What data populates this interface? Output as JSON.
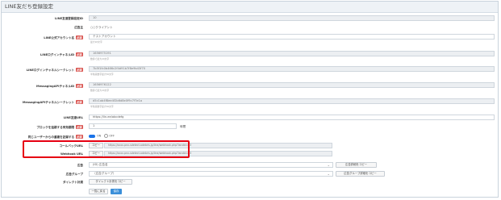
{
  "title": "LINE友だち登録設定",
  "fields": {
    "reg_id": {
      "label": "LINE友達登録設定ID",
      "value": "10"
    },
    "client": {
      "label": "広告主",
      "value": "○○クライアント"
    },
    "account_name": {
      "label": "LINE公式アカウント名",
      "required": "必須",
      "value": "テストアカウント",
      "hint": "最大20文字"
    },
    "login_channel_id": {
      "label": "LINEログインチャネルID",
      "required": "必須",
      "value": "1656975191",
      "hint": "数値で最大20文字"
    },
    "login_channel_secret": {
      "label": "LINEログインチャネルシークレット",
      "required": "必須",
      "value": "7b5f1fc0b466c2f4d91b7f8e9b43f70",
      "hint": "半角英数字最大50文字"
    },
    "msg_channel_id": {
      "label": "MessagingAPIチャネルID",
      "required": "必須",
      "value": "1656976122",
      "hint": "数値で最大20文字"
    },
    "msg_channel_secret": {
      "label": "MessagingAPIチャネルシークレット",
      "required": "必須",
      "value": "d5c1ab4f8ee4f2b6d8e0f9c7f7e1a",
      "hint": "半角英数字最大50文字"
    },
    "friend_url": {
      "label": "LINE友達URL",
      "value": "https://lin.ee/abcdefg"
    },
    "expire": {
      "label": "ブロックを追跡する有効期限",
      "required": "必須",
      "value": "1",
      "unit": "時間"
    },
    "same_user": {
      "label": "同じユーザーからの重複を記録する",
      "required": "必須",
      "on_label": "ON",
      "off_label": "OFF"
    },
    "callback_url": {
      "label": "コールバックURL",
      "copy": "コピー",
      "value": "https://xxxx.pnx-sdetect.adebris.jp/line/webhook.php?landid=23"
    },
    "webhook_url": {
      "label": "Webhook URL",
      "copy": "コピー",
      "value": "https://xxxx.pnx-sdetect.adebris.jp/line/webhook.php?landid=23"
    },
    "ad": {
      "label": "広告",
      "value": "(ID) 広告名",
      "copy": "広告詳細をコピー"
    },
    "ad_group": {
      "label": "広告グループ",
      "value": "（広告グループ）",
      "copy": "広告グループ詳細をコピー"
    },
    "direct": {
      "label": "ダイレクト計測",
      "button": "ダイレクト計測をコピー"
    }
  },
  "actions": {
    "back": "一覧に戻る",
    "save": "保存"
  }
}
